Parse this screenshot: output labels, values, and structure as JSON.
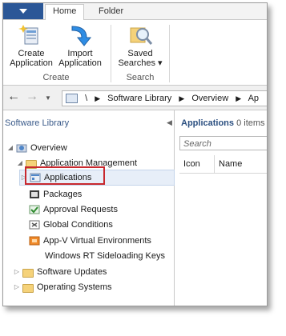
{
  "ribbon": {
    "tabs": [
      "Home",
      "Folder"
    ],
    "buttons": {
      "create_application": "Create\nApplication",
      "import_application": "Import\nApplication",
      "saved_searches": "Saved\nSearches ▾"
    },
    "groups": [
      "Create",
      "Search"
    ]
  },
  "addressbar": {
    "path": [
      "\\",
      "Software Library",
      "Overview",
      "Ap"
    ]
  },
  "leftpane": {
    "title": "Software Library",
    "tree": [
      {
        "label": "Overview"
      },
      {
        "label": "Application Management"
      },
      {
        "label": "Applications"
      },
      {
        "label": "Packages"
      },
      {
        "label": "Approval Requests"
      },
      {
        "label": "Global Conditions"
      },
      {
        "label": "App-V Virtual Environments"
      },
      {
        "label": "Windows RT Sideloading Keys"
      },
      {
        "label": "Software Updates"
      },
      {
        "label": "Operating Systems"
      }
    ]
  },
  "rightpane": {
    "title_bold": "Applications",
    "title_rest": " 0 items",
    "search_placeholder": "Search",
    "columns": [
      "Icon",
      "Name"
    ]
  },
  "colors": {
    "file_tab": "#2b5797",
    "highlight_box": "#c8282e",
    "pane_title": "#3b5b8a",
    "folder": "#f5d27a"
  }
}
